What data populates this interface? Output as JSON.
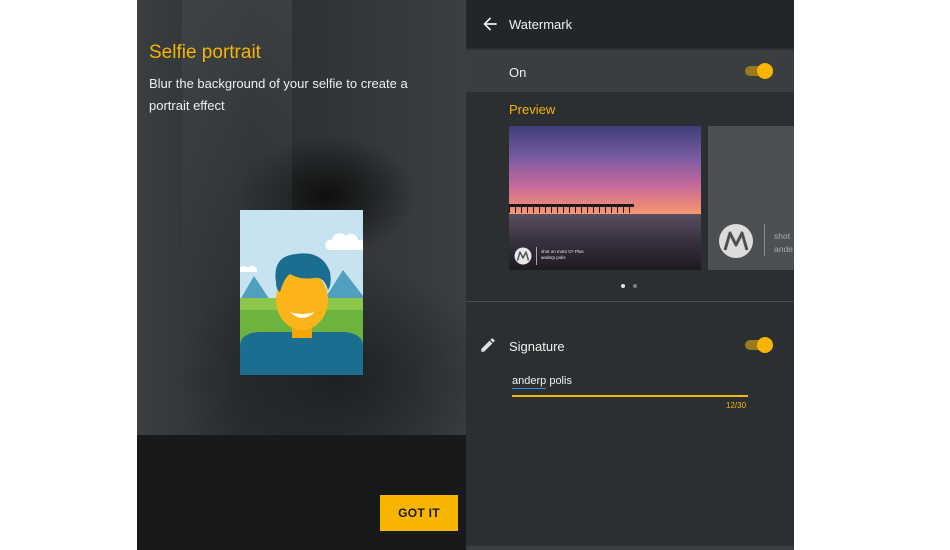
{
  "left": {
    "title": "Selfie portrait",
    "description": "Blur the background of your selfie to create a portrait effect",
    "button_label": "GOT IT",
    "illustration_icon": "selfie-portrait-illustration",
    "colors": {
      "accent": "#f7b500",
      "text": "#f0f0f0"
    }
  },
  "right": {
    "appbar": {
      "title": "Watermark",
      "back_icon": "arrow-left-icon"
    },
    "on_row": {
      "label": "On",
      "toggle_on": true
    },
    "preview": {
      "label": "Preview",
      "watermark_text_line1": "shot on moto G⁶ Plus",
      "watermark_text_line2": "anderp polis",
      "card2_line1": "shot",
      "card2_line2": "ande",
      "page_index": 0,
      "page_count": 2
    },
    "signature": {
      "label": "Signature",
      "toggle_on": true,
      "value_part1": "anderp",
      "value_part2": " polis",
      "counter": "12/30",
      "icon": "pencil-icon"
    },
    "colors": {
      "accent": "#f7b500",
      "dot_active": "#e8e8e8",
      "dot_inactive": "#7a7e80"
    }
  }
}
